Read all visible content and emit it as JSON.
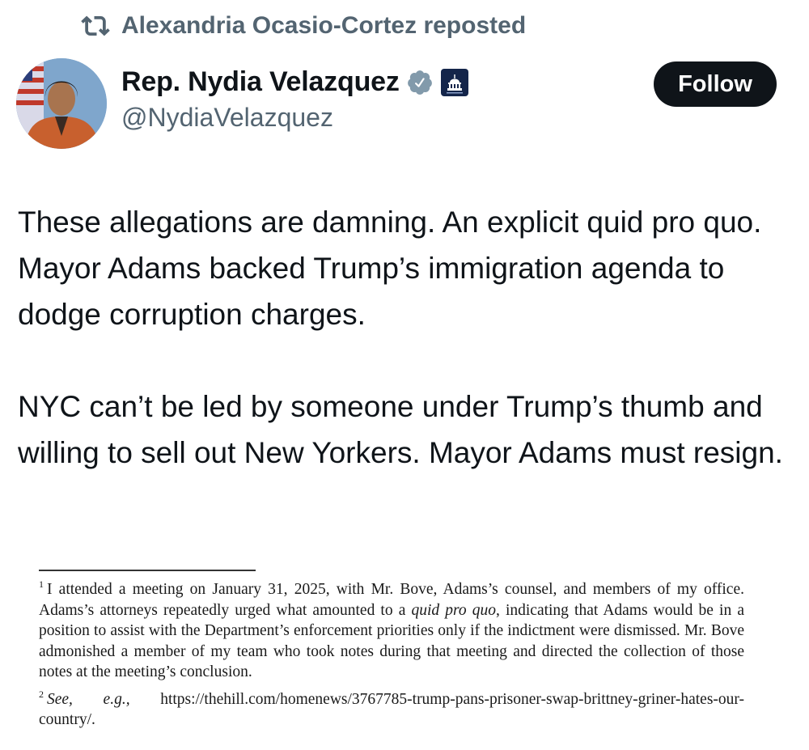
{
  "repost": {
    "label": "Alexandria Ocasio-Cortez reposted",
    "icon": "repost-icon"
  },
  "author": {
    "display_name": "Rep. Nydia Velazquez",
    "handle": "@NydiaVelazquez",
    "verified_icon": "verified-badge-icon",
    "affiliation_icon": "capitol-affiliation-icon"
  },
  "follow_label": "Follow",
  "tweet": {
    "paragraphs": [
      "These allegations are damning. An explicit quid pro quo. Mayor Adams backed Trump’s immigration agenda to dodge corruption charges.",
      "NYC can’t be led by someone under Trump’s thumb and willing to sell out New Yorkers. Mayor Adams must resign."
    ]
  },
  "document": {
    "footnote1": {
      "number": "1",
      "before_italic": "I attended a meeting on January 31, 2025, with Mr. Bove, Adams’s counsel, and members of my office. Adams’s attorneys repeatedly urged what amounted to a ",
      "italic": "quid pro quo",
      "after_italic": ", indicating that Adams would be in a position to assist with the Department’s enforcement priorities only if the indictment were dismissed. Mr. Bove admonished a member of my team who took notes during that meeting and directed the collection of those notes at the meeting’s conclusion."
    },
    "footnote2": {
      "number": "2",
      "see": "See, e.g.,",
      "text": "https://thehill.com/homenews/3767785-trump-pans-prisoner-swap-brittney-griner-hates-our-country/."
    }
  },
  "colors": {
    "text": "#0f1419",
    "secondary": "#536471",
    "verified": "#829aab",
    "follow_bg": "#0f1419"
  }
}
